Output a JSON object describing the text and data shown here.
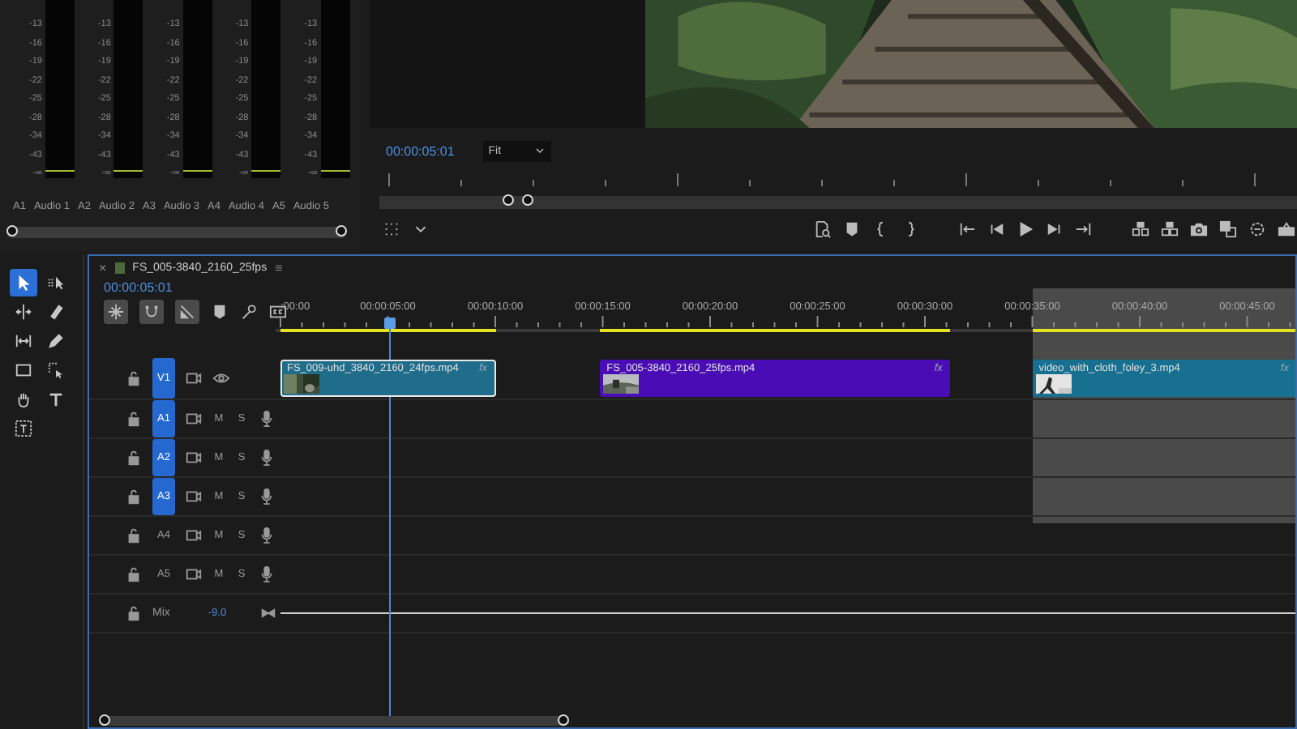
{
  "audio_meters": {
    "channels": [
      {
        "track": "A1",
        "name": "Audio 1",
        "scale": [
          "-13",
          "-16",
          "-19",
          "-22",
          "-25",
          "-28",
          "-34",
          "-43",
          "-∞"
        ]
      },
      {
        "track": "A2",
        "name": "Audio 2",
        "scale": [
          "-13",
          "-16",
          "-19",
          "-22",
          "-25",
          "-28",
          "-34",
          "-43",
          "-∞"
        ]
      },
      {
        "track": "A3",
        "name": "Audio 3",
        "scale": [
          "-13",
          "-16",
          "-19",
          "-22",
          "-25",
          "-28",
          "-34",
          "-43",
          "-∞"
        ]
      },
      {
        "track": "A4",
        "name": "Audio 4",
        "scale": [
          "-13",
          "-16",
          "-19",
          "-22",
          "-25",
          "-28",
          "-34",
          "-43",
          "-∞"
        ]
      },
      {
        "track": "A5",
        "name": "Audio 5",
        "scale": [
          "-13",
          "-16",
          "-19",
          "-22",
          "-25",
          "-28",
          "-34",
          "-43",
          "-∞"
        ]
      }
    ]
  },
  "program_monitor": {
    "timecode": "00:00:05:01",
    "zoom": "Fit"
  },
  "tools": [
    {
      "kind": "selection",
      "selected": true
    },
    {
      "kind": "track-select",
      "selected": false
    },
    {
      "kind": "ripple",
      "selected": false
    },
    {
      "kind": "razor",
      "selected": false
    },
    {
      "kind": "slip",
      "selected": false
    },
    {
      "kind": "pen",
      "selected": false
    },
    {
      "kind": "rectangle",
      "selected": false
    },
    {
      "kind": "zoom-box",
      "selected": false
    },
    {
      "kind": "hand",
      "selected": false
    },
    {
      "kind": "type",
      "selected": false
    },
    {
      "kind": "caption-box",
      "selected": false
    }
  ],
  "timeline": {
    "close": "×",
    "title": "FS_005-3840_2160_25fps",
    "menu": "≡",
    "timecode": "00:00:05:01",
    "ruler": [
      ":00:00",
      "00:00:05:00",
      "00:00:10:00",
      "00:00:15:00",
      "00:00:20:00",
      "00:00:25:00",
      "00:00:30:00",
      "00:00:35:00",
      "00:00:40:00",
      "00:00:45:00"
    ],
    "video_tracks": [
      {
        "label": "V1",
        "targeted": true
      }
    ],
    "clips": [
      {
        "name": "FS_009-uhd_3840_2160_24fps.mp4",
        "color": "#1f6d8a",
        "selected": true,
        "highlighted": false,
        "badge": "fx"
      },
      {
        "name": "FS_005-3840_2160_25fps.mp4",
        "color": "#4a0cb5",
        "selected": false,
        "highlighted": false,
        "badge": "fx"
      },
      {
        "name": "video_with_cloth_foley_3.mp4",
        "color": "#17708f",
        "selected": false,
        "highlighted": true,
        "badge": "fx"
      }
    ],
    "audio_tracks": [
      {
        "label": "A1",
        "targeted": true,
        "mute": "M",
        "solo": "S"
      },
      {
        "label": "A2",
        "targeted": true,
        "mute": "M",
        "solo": "S"
      },
      {
        "label": "A3",
        "targeted": true,
        "mute": "M",
        "solo": "S"
      },
      {
        "label": "A4",
        "targeted": false,
        "mute": "M",
        "solo": "S"
      },
      {
        "label": "A5",
        "targeted": false,
        "mute": "M",
        "solo": "S"
      }
    ],
    "mix": {
      "label": "Mix",
      "value": "-9.0"
    }
  }
}
